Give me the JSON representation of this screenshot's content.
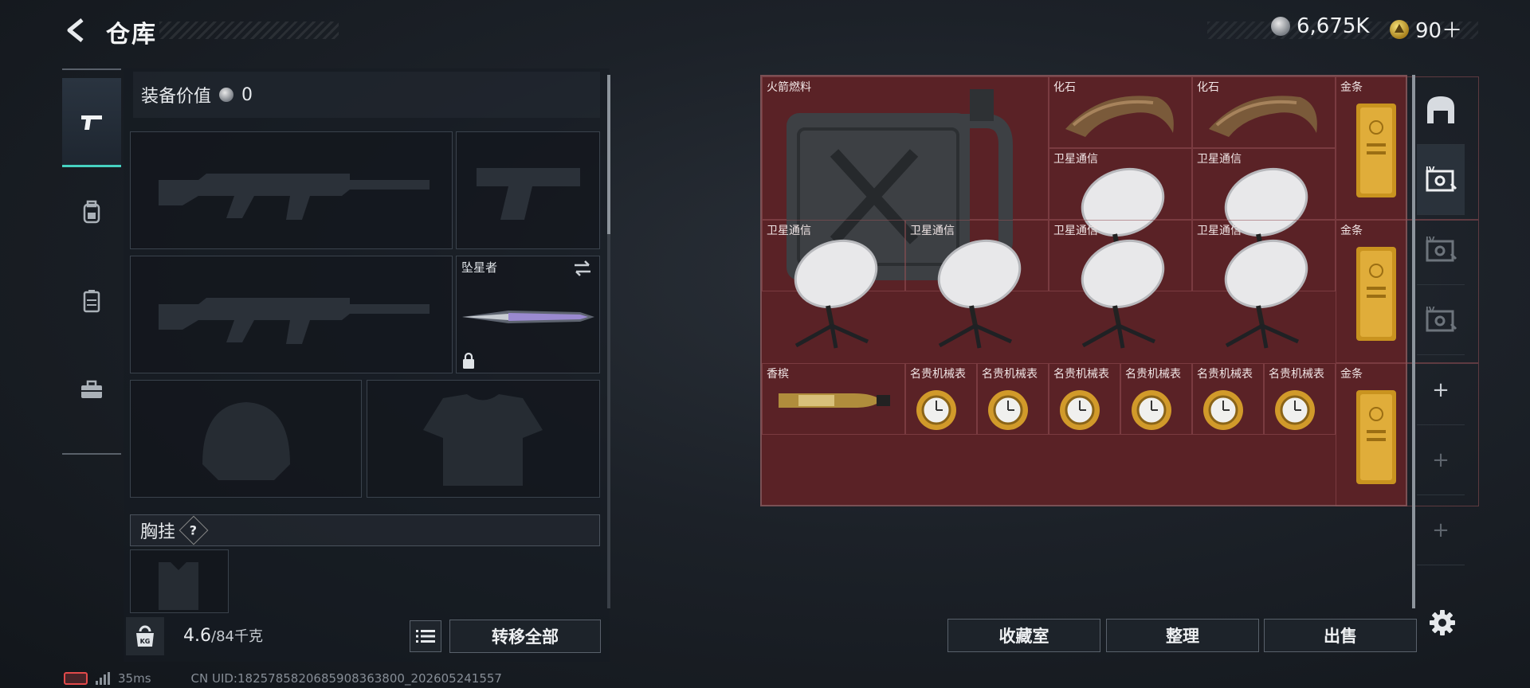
{
  "header": {
    "title": "仓库",
    "coins": "6,675K",
    "gold": "90＋"
  },
  "left_nav": {
    "items": [
      {
        "name": "weapons",
        "icon": "pistol-icon",
        "active": true
      },
      {
        "name": "backpack",
        "icon": "backpack-icon",
        "active": false
      },
      {
        "name": "chest-rig",
        "icon": "vest-icon",
        "active": false
      },
      {
        "name": "toolbox",
        "icon": "toolbox-icon",
        "active": false
      }
    ]
  },
  "equipment": {
    "value_label": "装备价值",
    "value": "0",
    "melee_name": "坠星者",
    "vest_label": "胸挂",
    "vest_help": "?"
  },
  "inventory": {
    "weight_current": "4.6",
    "weight_max": "/84千克",
    "weight_icon_text": "KG",
    "transfer_all": "转移全部"
  },
  "stash": {
    "items": [
      {
        "label": "火箭燃料",
        "icon": "fuel-can-icon"
      },
      {
        "label": "化石",
        "icon": "fossil-claw-icon"
      },
      {
        "label": "化石",
        "icon": "fossil-claw-icon"
      },
      {
        "label": "金条",
        "icon": "gold-bar-icon"
      },
      {
        "label": "卫星通信",
        "icon": "satellite-dish-icon"
      },
      {
        "label": "卫星通信",
        "icon": "satellite-dish-icon"
      },
      {
        "label": "金条",
        "icon": "gold-bar-icon"
      },
      {
        "label": "卫星通信",
        "icon": "satellite-dish-icon"
      },
      {
        "label": "卫星通信",
        "icon": "satellite-dish-icon"
      },
      {
        "label": "卫星通信",
        "icon": "satellite-dish-icon"
      },
      {
        "label": "卫星通信",
        "icon": "satellite-dish-icon"
      },
      {
        "label": "金条",
        "icon": "gold-bar-icon"
      },
      {
        "label": "香槟",
        "icon": "champagne-icon"
      },
      {
        "label": "名贵机械表",
        "icon": "watch-icon"
      },
      {
        "label": "名贵机械表",
        "icon": "watch-icon"
      },
      {
        "label": "名贵机械表",
        "icon": "watch-icon"
      },
      {
        "label": "名贵机械表",
        "icon": "watch-icon"
      },
      {
        "label": "名贵机械表",
        "icon": "watch-icon"
      },
      {
        "label": "名贵机械表",
        "icon": "watch-icon"
      }
    ]
  },
  "actions": {
    "collection": "收藏室",
    "sort": "整理",
    "sell": "出售"
  },
  "right_tabs": {
    "tier_label": "IV"
  },
  "status": {
    "ping": "35ms",
    "uid": "CN UID:1825785820685908363800_202605241557"
  }
}
